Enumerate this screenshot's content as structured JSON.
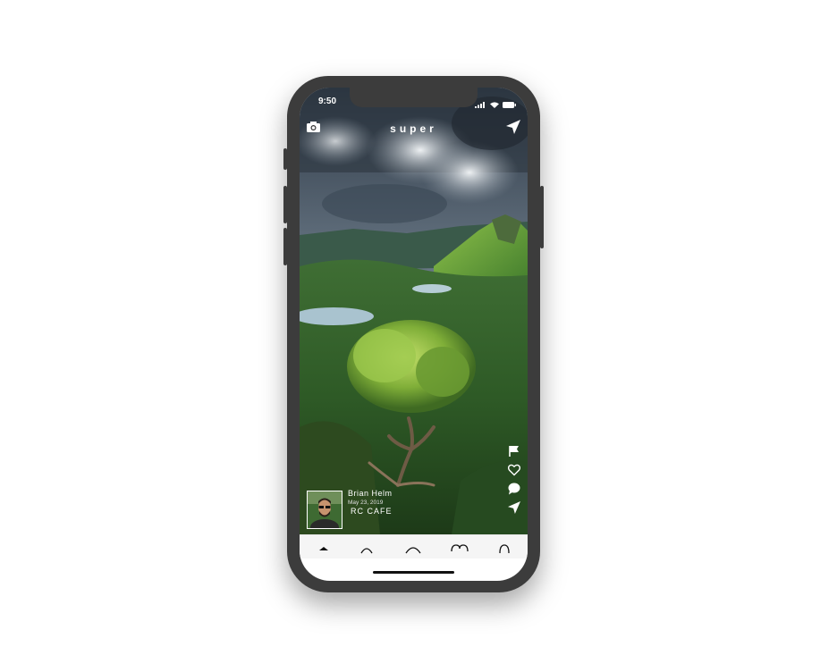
{
  "status_bar": {
    "time": "9:50",
    "icons": [
      "signal-icon",
      "wifi-icon",
      "battery-icon"
    ]
  },
  "header": {
    "brand": "super",
    "left_icon": "camera-icon",
    "right_icon": "send-icon"
  },
  "post": {
    "user_name": "Brian Helm",
    "date": "May 23, 2019",
    "place": "RC CAFE",
    "actions": [
      "flag-icon",
      "heart-icon",
      "comment-icon",
      "share-icon"
    ]
  },
  "tabs": [
    "home-icon",
    "search-icon",
    "camera-icon",
    "heart-icon",
    "profile-icon"
  ],
  "colors": {
    "device": "#3c3c3c",
    "tab_bar": "#f5f5f5",
    "accent": "#ffffff"
  }
}
